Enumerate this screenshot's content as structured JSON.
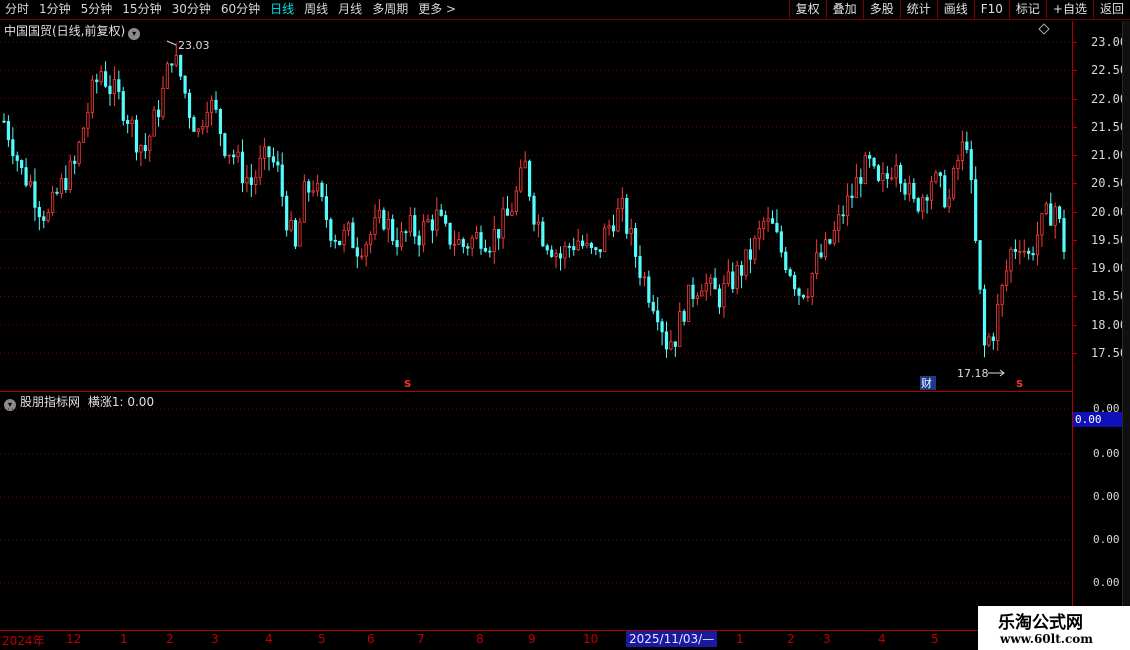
{
  "toolbar": {
    "periods": [
      "分时",
      "1分钟",
      "5分钟",
      "15分钟",
      "30分钟",
      "60分钟",
      "日线",
      "周线",
      "月线",
      "多周期",
      "更多"
    ],
    "active_period": "日线",
    "tools": [
      "复权",
      "叠加",
      "多股",
      "统计",
      "画线",
      "F10",
      "标记",
      "+自选",
      "返回"
    ]
  },
  "main": {
    "title": "中国国贸(日线,前复权)",
    "high_label": "23.03",
    "low_label": "17.18",
    "marker_s1": "S",
    "marker_cai": "财",
    "marker_s2": "S"
  },
  "indicator": {
    "title": "股朋指标网",
    "series_label": "横涨1:",
    "series_value": "0.00",
    "current_value": "0.00",
    "ticks": [
      "0.00",
      "0.00",
      "0.00",
      "0.00",
      "0.00"
    ]
  },
  "time_axis": {
    "labels": [
      "2024年",
      "12",
      "1",
      "2",
      "3",
      "4",
      "5",
      "6",
      "7",
      "8",
      "9",
      "10",
      "1",
      "2",
      "3",
      "4",
      "5"
    ],
    "cursor": "2025/11/03/—"
  },
  "watermark": {
    "name": "乐淘公式网",
    "url": "www.60lt.com"
  },
  "colors": {
    "up": "#ff3b3b",
    "down": "#54fcfc",
    "grid": "#7a0000",
    "axis": "#b00000",
    "active": "#00e5e5"
  },
  "chart_data": {
    "type": "candlestick",
    "y_ticks": [
      17.5,
      18.0,
      18.5,
      19.0,
      19.5,
      20.0,
      20.5,
      21.0,
      21.5,
      22.0,
      22.5,
      23.0
    ],
    "ylim": [
      17.0,
      23.4
    ],
    "grid": true,
    "high": 23.03,
    "low": 17.18,
    "close_path": [
      21.6,
      21.2,
      20.7,
      20.5,
      20.1,
      19.9,
      20.3,
      20.6,
      20.8,
      21.5,
      22.1,
      22.5,
      22.2,
      22.0,
      21.7,
      21.3,
      21.1,
      21.6,
      22.1,
      22.8,
      22.4,
      21.8,
      21.4,
      22.0,
      21.7,
      21.2,
      21.0,
      20.7,
      20.5,
      20.8,
      21.0,
      20.7,
      19.9,
      19.3,
      20.3,
      20.5,
      20.1,
      19.7,
      19.5,
      19.6,
      19.4,
      19.5,
      19.7,
      19.9,
      19.6,
      19.5,
      19.7,
      19.6,
      19.8,
      19.9,
      19.6,
      19.5,
      19.4,
      19.5,
      19.6,
      19.5,
      19.7,
      19.9,
      20.3,
      20.8,
      20.0,
      19.6,
      19.4,
      19.2,
      19.4,
      19.5,
      19.3,
      19.2,
      19.6,
      19.9,
      20.0,
      19.5,
      19.0,
      18.6,
      18.3,
      17.7,
      17.8,
      18.3,
      18.6,
      18.8,
      18.6,
      18.5,
      18.7,
      18.9,
      19.1,
      19.4,
      19.8,
      19.7,
      19.3,
      19.0,
      18.6,
      18.7,
      19.1,
      19.3,
      19.6,
      20.0,
      20.3,
      20.7,
      20.8,
      20.4,
      20.6,
      21.0,
      20.5,
      20.1,
      20.3,
      20.6,
      20.4,
      20.2,
      20.9,
      21.3,
      19.4,
      17.6,
      17.9,
      18.6,
      19.3,
      19.5,
      19.2,
      19.6,
      19.9,
      20.1,
      19.4
    ]
  }
}
